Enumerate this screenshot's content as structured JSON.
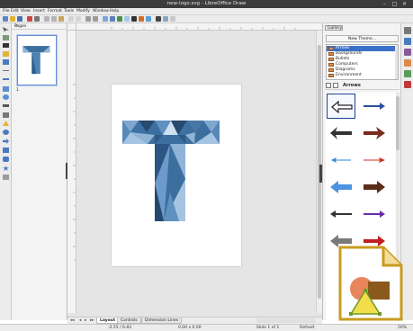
{
  "window": {
    "title": "new-logo.svg - LibreOffice Draw",
    "controls": [
      "–",
      "□",
      "✕"
    ]
  },
  "menu": {
    "items": [
      "File",
      "Edit",
      "View",
      "Insert",
      "Format",
      "Tools",
      "Modify",
      "Window",
      "Help"
    ]
  },
  "pages_pane": {
    "title": "Pages",
    "close": "×",
    "page_number": "1"
  },
  "gallery": {
    "tab_label": "Gallery",
    "new_theme_button": "New Theme...",
    "themes": [
      {
        "label": "Arrows",
        "selected": true
      },
      {
        "label": "Backgrounds",
        "selected": false
      },
      {
        "label": "Bullets",
        "selected": false
      },
      {
        "label": "Computers",
        "selected": false
      },
      {
        "label": "Diagrams",
        "selected": false
      },
      {
        "label": "Environment",
        "selected": false
      }
    ],
    "current_theme": "Arrows",
    "items": [
      {
        "icon": "arrow-left-outline-icon",
        "color": "#222222"
      },
      {
        "icon": "arrow-right-blue-icon",
        "color": "#2a4fa0"
      },
      {
        "icon": "arrow-left-black-icon",
        "color": "#333333"
      },
      {
        "icon": "arrow-right-darkred-icon",
        "color": "#7a2a1e"
      },
      {
        "icon": "arrow-left-thin-blue-icon",
        "color": "#2e86d8"
      },
      {
        "icon": "arrow-right-thin-red-icon",
        "color": "#d03020"
      },
      {
        "icon": "arrow-left-lightblue-icon",
        "color": "#4d94e0"
      },
      {
        "icon": "arrow-right-brown-icon",
        "color": "#5a2e1a"
      },
      {
        "icon": "arrow-left-dark-icon",
        "color": "#333333"
      },
      {
        "icon": "arrow-right-purple-icon",
        "color": "#6a2da8"
      },
      {
        "icon": "arrow-left-gray-icon",
        "color": "#7a7a7a"
      },
      {
        "icon": "arrow-right-red-icon",
        "color": "#c02020"
      }
    ]
  },
  "tabs": {
    "items": [
      {
        "label": "Layout",
        "active": true
      },
      {
        "label": "Controls",
        "active": false
      },
      {
        "label": "Dimension Lines",
        "active": false
      }
    ]
  },
  "status": {
    "position": "-2.55 / 6.83",
    "size": "0.00 x 0.00",
    "slide": "Slide 1 of 1",
    "layout": "Default",
    "zoom": "50%"
  },
  "colors": {
    "accent": "#3b71c8",
    "logo_blue": "#3d6f9e",
    "logo_frame": "#c99c1f"
  }
}
